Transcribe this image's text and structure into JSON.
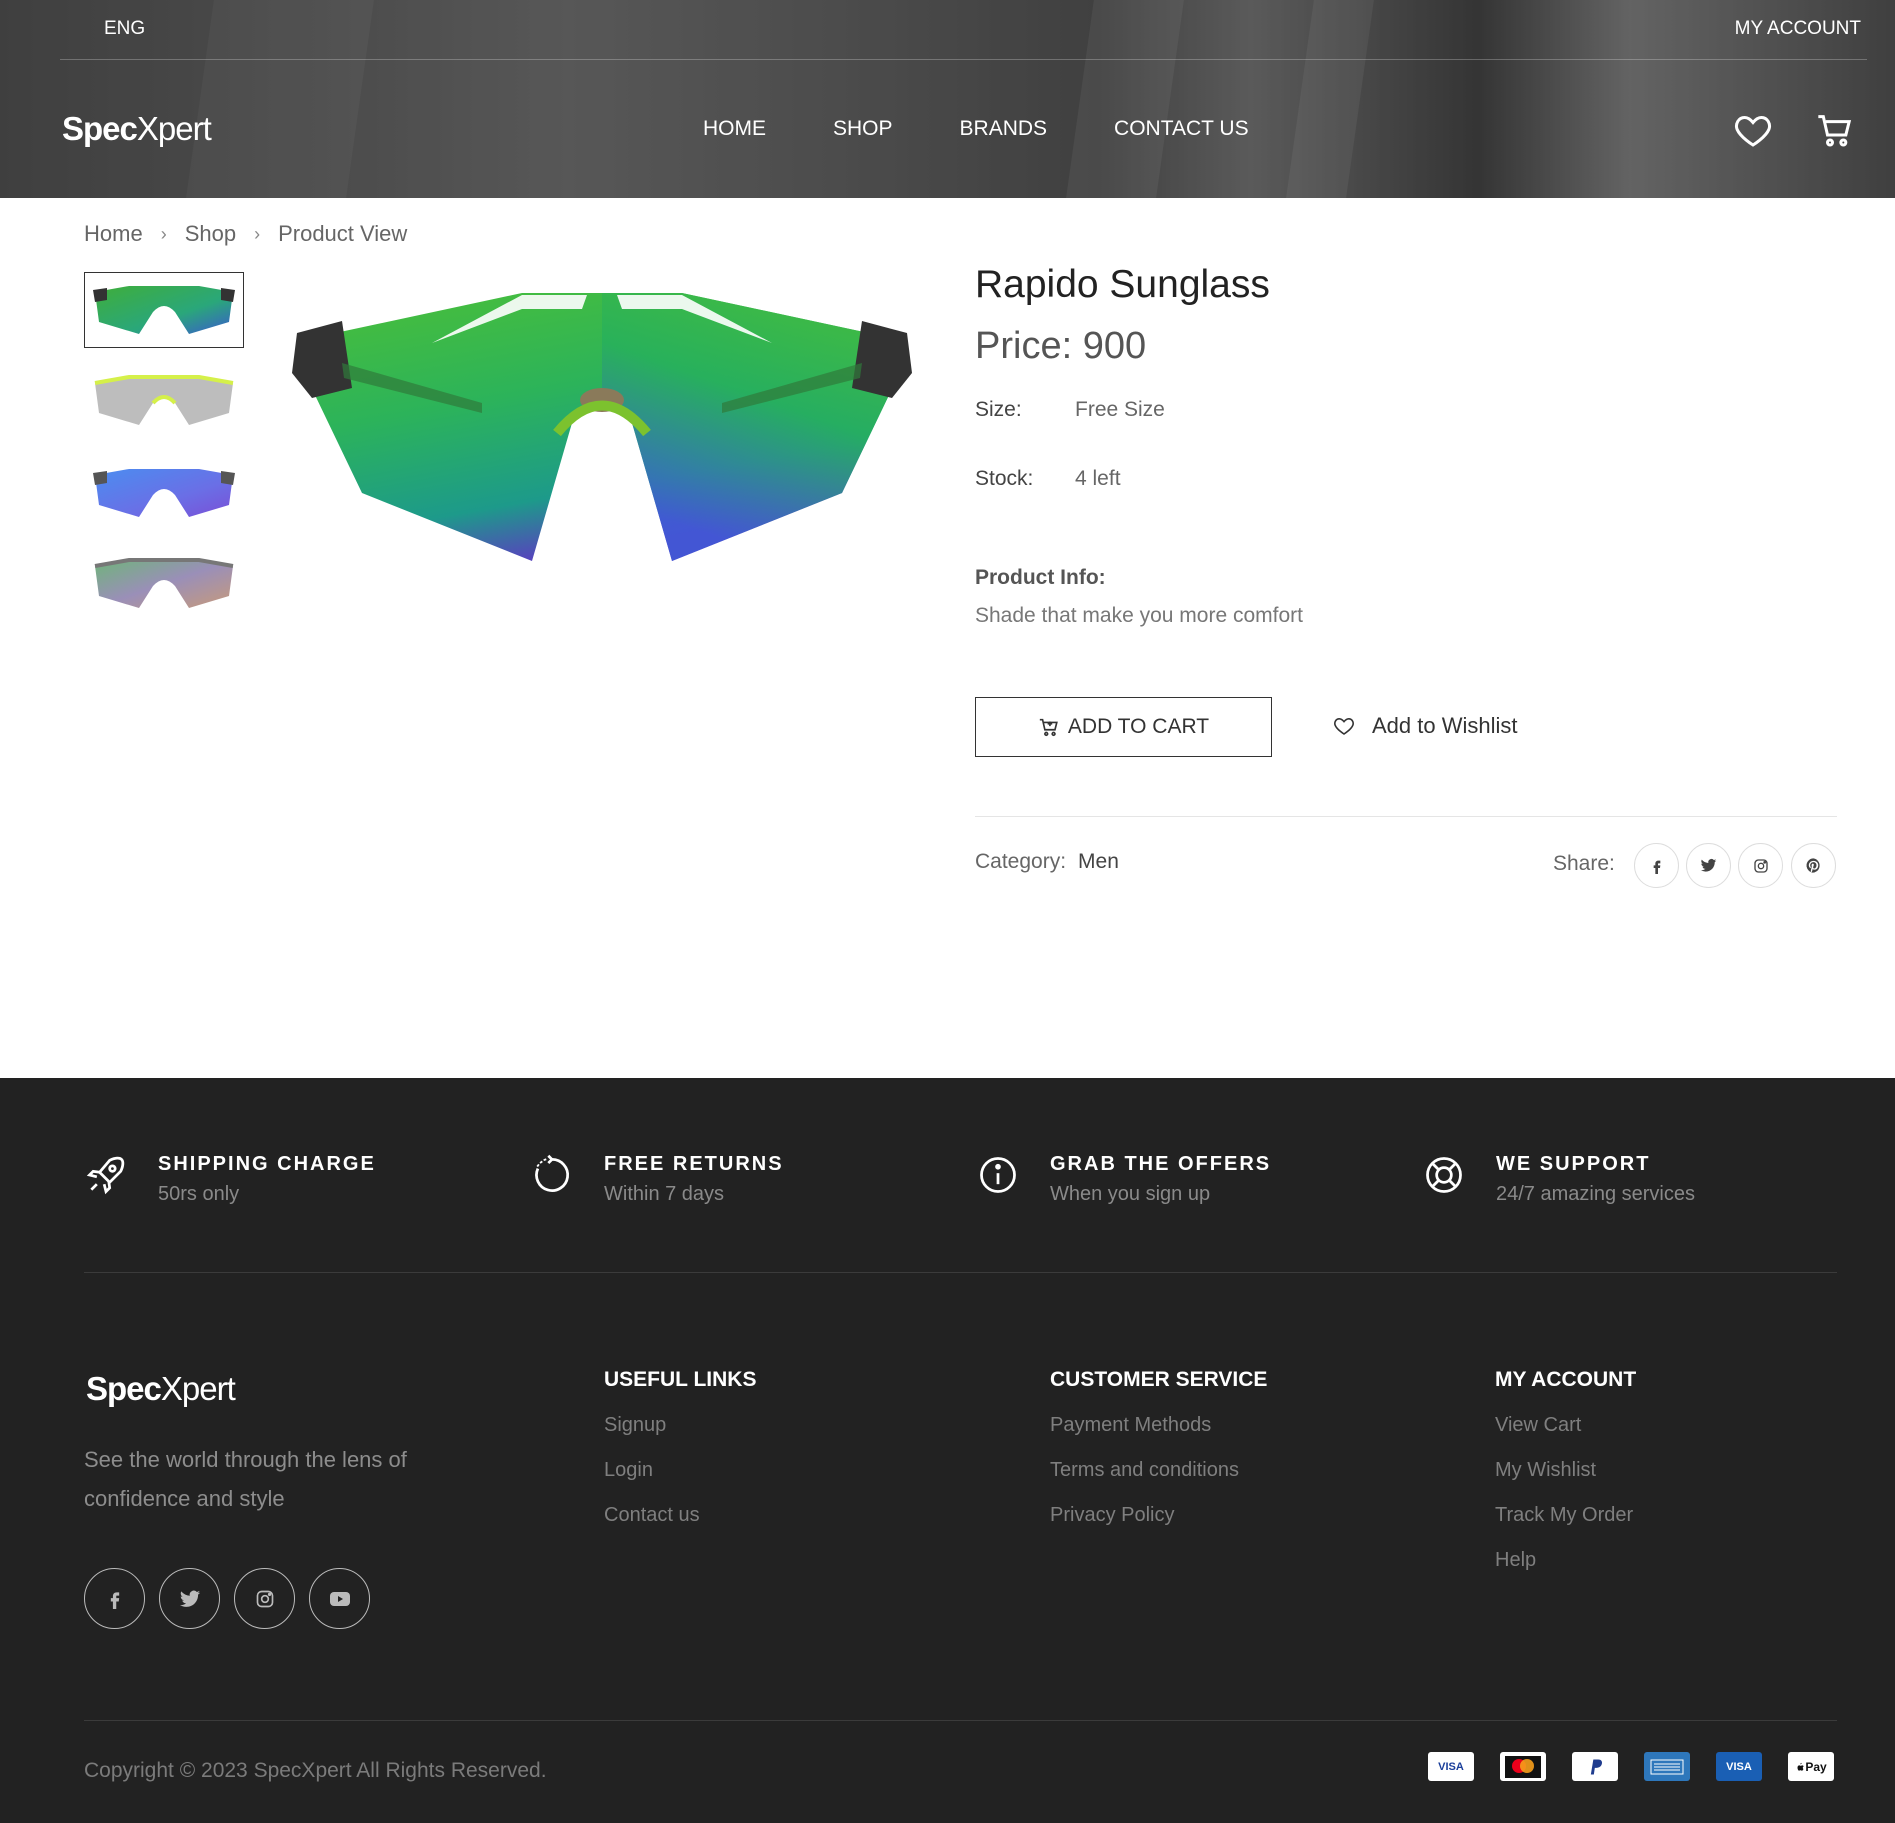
{
  "header": {
    "language": "ENG",
    "my_account": "MY ACCOUNT",
    "logo_bold": "Spec",
    "logo_light": "Xpert",
    "nav": [
      "HOME",
      "SHOP",
      "BRANDS",
      "CONTACT US"
    ]
  },
  "breadcrumb": [
    "Home",
    "Shop",
    "Product View"
  ],
  "product": {
    "title": "Rapido Sunglass",
    "price": "Price: 900",
    "size_label": "Size:",
    "size_value": "Free Size",
    "stock_label": "Stock:",
    "stock_value": "4 left",
    "info_heading": "Product Info:",
    "info_text": "Shade that make you more comfort",
    "add_to_cart": "ADD TO CART",
    "add_to_wishlist": "Add to Wishlist",
    "category_label": "Category:",
    "category_value": "Men",
    "share_label": "Share:"
  },
  "features": [
    {
      "title": "SHIPPING CHARGE",
      "subtitle": "50rs only",
      "icon": "rocket-icon"
    },
    {
      "title": "FREE RETURNS",
      "subtitle": "Within 7 days",
      "icon": "return-icon"
    },
    {
      "title": "GRAB THE OFFERS",
      "subtitle": "When you sign up",
      "icon": "info-icon"
    },
    {
      "title": "WE SUPPORT",
      "subtitle": "24/7 amazing services",
      "icon": "lifebuoy-icon"
    }
  ],
  "footer": {
    "logo_bold": "Spec",
    "logo_light": "Xpert",
    "tagline": "See the world through the lens of confidence and style",
    "useful_links": {
      "heading": "USEFUL LINKS",
      "links": [
        "Signup",
        "Login",
        "Contact us"
      ]
    },
    "customer_service": {
      "heading": "CUSTOMER SERVICE",
      "links": [
        "Payment Methods",
        "Terms and conditions",
        "Privacy Policy"
      ]
    },
    "my_account": {
      "heading": "MY ACCOUNT",
      "links": [
        "View Cart",
        "My Wishlist",
        "Track My Order",
        "Help"
      ]
    },
    "copyright": "Copyright © 2023 SpecXpert All Rights Reserved.",
    "payment_methods": [
      "VISA",
      "Mastercard",
      "PayPal",
      "American Express",
      "VISA",
      "Pay"
    ]
  },
  "colors": {
    "footer_bg": "#222222",
    "lens_green": "#2fbf4f",
    "lens_blue": "#3a7bd5"
  }
}
